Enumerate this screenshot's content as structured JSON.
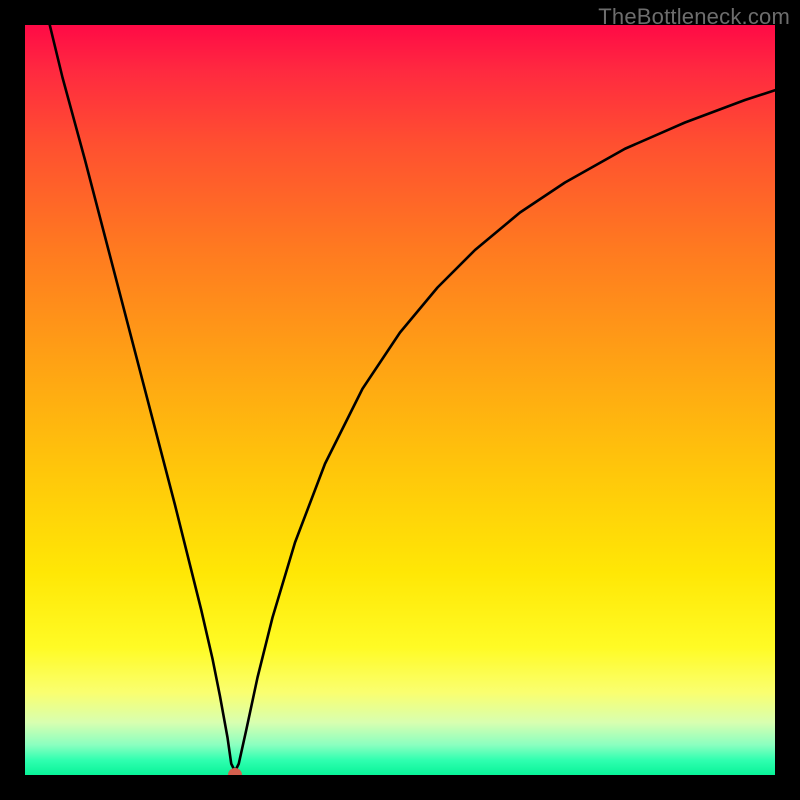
{
  "watermark": {
    "text": "TheBottleneck.com"
  },
  "chart_data": {
    "type": "line",
    "title": "",
    "xlabel": "",
    "ylabel": "",
    "xlim": [
      0,
      100
    ],
    "ylim": [
      0,
      100
    ],
    "grid": false,
    "legend": false,
    "background_gradient": {
      "top": "#ff0a46",
      "mid": "#ffe400",
      "bottom": "#08f398"
    },
    "series": [
      {
        "name": "bottleneck-curve",
        "color": "#000000",
        "x": [
          3.3,
          5,
          8,
          11,
          14,
          17,
          20,
          22,
          23.5,
          25,
          26,
          27,
          27.5,
          28,
          28.5,
          29.5,
          31,
          33,
          36,
          40,
          45,
          50,
          55,
          60,
          66,
          72,
          80,
          88,
          96,
          100
        ],
        "y": [
          100,
          93,
          82,
          70.5,
          59,
          47.5,
          36,
          28,
          22,
          15.5,
          10.5,
          5,
          1.5,
          0.5,
          1.5,
          6,
          13,
          21,
          31,
          41.5,
          51.5,
          59,
          65,
          70,
          75,
          79,
          83.5,
          87,
          90,
          91.3
        ]
      }
    ],
    "marker": {
      "name": "optimum-dot",
      "x": 28,
      "y": 0,
      "color": "#d4604f",
      "radius_px": 7
    }
  }
}
